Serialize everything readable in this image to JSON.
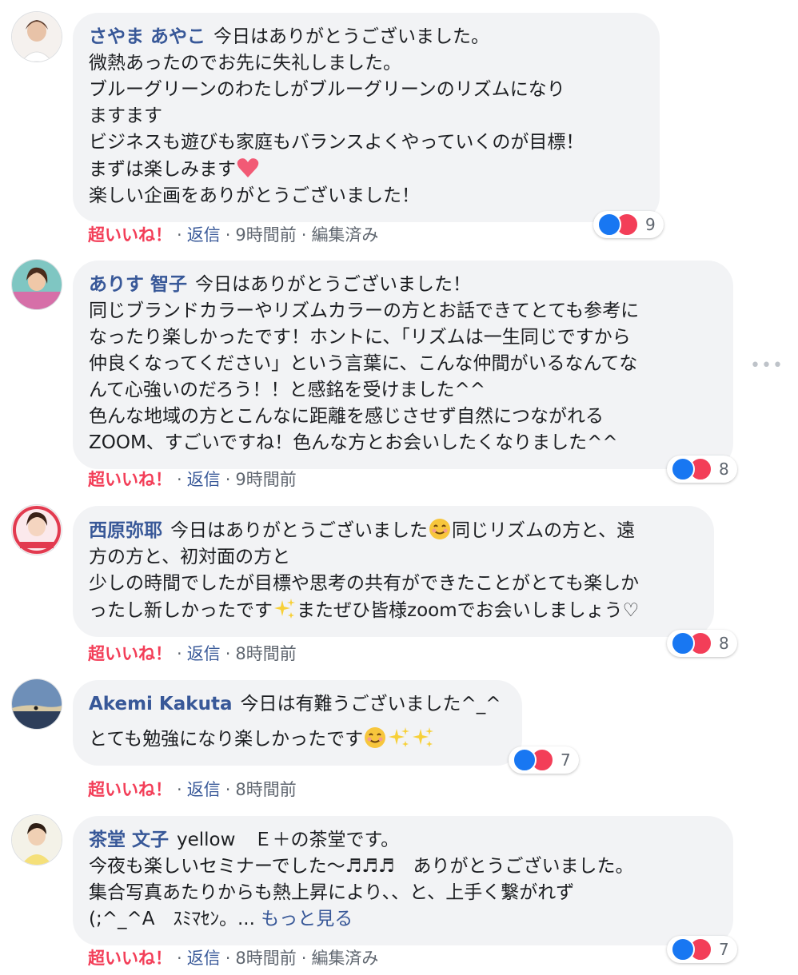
{
  "comments": [
    {
      "author": "さやま あやこ",
      "lines": [
        "今日はありがとうございました。",
        "微熱あったのでお先に失礼しました。",
        "ブルーグリーンのわたしがブルーグリーンのリズムになり",
        "ますます",
        "ビジネスも遊びも家庭もバランスよくやっていくのが目標！",
        "まずは楽しみます",
        "楽しい企画をありがとうございました！"
      ],
      "actions": {
        "love": "超いいね！",
        "reply": "返信",
        "time": "9時間前",
        "edited": "編集済み"
      },
      "reaction_count": "9"
    },
    {
      "author": "ありす 智子",
      "lines": [
        "今日はありがとうございました！",
        "同じブランドカラーやリズムカラーの方とお話できてとても参考に",
        "なったり楽しかったです！ホントに、「リズムは一生同じですから",
        "仲良くなってください」という言葉に、こんな仲間がいるなんてな",
        "んて心強いのだろう！！と感銘を受けました^^",
        "色んな地域の方とこんなに距離を感じさせず自然につながれる",
        "ZOOM、すごいですね！色んな方とお会いしたくなりました^^"
      ],
      "actions": {
        "love": "超いいね！",
        "reply": "返信",
        "time": "9時間前"
      },
      "reaction_count": "8"
    },
    {
      "author": "西原弥耶",
      "lines": [
        "今日はありがとうございました",
        "同じリズムの方と、遠",
        "方の方と、初対面の方と",
        "少しの時間でしたが目標や思考の共有ができたことがとても楽しか",
        "ったし新しかったです",
        "またぜひ皆様zoomでお会いしましょう♡"
      ],
      "actions": {
        "love": "超いいね！",
        "reply": "返信",
        "time": "8時間前"
      },
      "reaction_count": "8"
    },
    {
      "author": "Akemi Kakuta",
      "lines": [
        "今日は有難うございました^_^",
        "とても勉強になり楽しかったです"
      ],
      "actions": {
        "love": "超いいね！",
        "reply": "返信",
        "time": "8時間前"
      },
      "reaction_count": "7"
    },
    {
      "author": "茶堂 文子",
      "lines": [
        "yellow　Ｅ＋の茶堂です。",
        "今夜も楽しいセミナーでした〜♬♬♬　ありがとうございました。",
        "集合写真あたりからも熱上昇により、、と、上手く繋がれず",
        "(;^_^A　ｽﾐﾏｾﾝ。... "
      ],
      "see_more": "もっと見る",
      "actions": {
        "love": "超いいね！",
        "reply": "返信",
        "time": "8時間前",
        "edited": "編集済み"
      },
      "reaction_count": "7"
    }
  ],
  "separator": "·",
  "options_icon": "more-horizontal-icon",
  "options_glyph": "•••",
  "colors": {
    "author": "#385898",
    "love": "#f33e58",
    "like": "#1877f2",
    "bubble": "#f2f3f5",
    "meta": "#606770"
  }
}
